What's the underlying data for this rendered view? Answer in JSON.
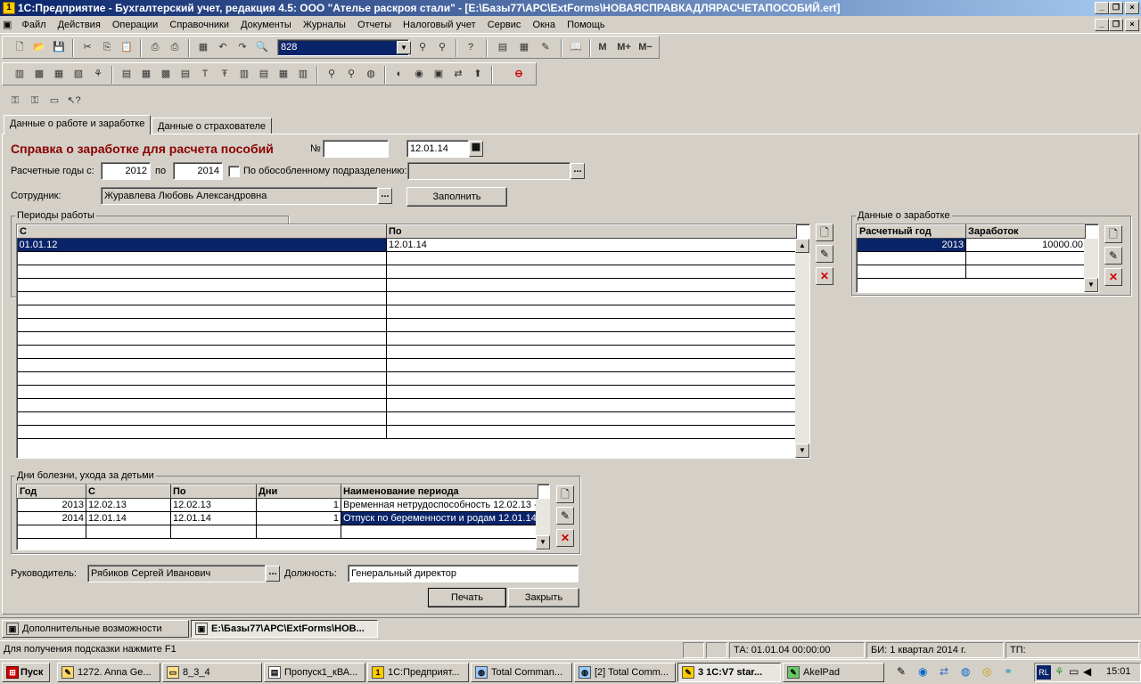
{
  "window": {
    "title": "1С:Предприятие - Бухгалтерский учет, редакция 4.5: ООО \"Ателье раскроя стали\" - [E:\\Базы77\\АРС\\ExtForms\\НОВАЯСПРАВКАДЛЯРАСЧЕТАПОСОБИЙ.ert]"
  },
  "menu": [
    "Файл",
    "Действия",
    "Операции",
    "Справочники",
    "Документы",
    "Журналы",
    "Отчеты",
    "Налоговый учет",
    "Сервис",
    "Окна",
    "Помощь"
  ],
  "toolbar": {
    "search_value": "828",
    "m_label": "M",
    "mplus_label": "M+",
    "mminus_label": "M−"
  },
  "tabs": [
    "Данные о работе и заработке",
    "Данные о страхователе"
  ],
  "form": {
    "title": "Справка о заработке для расчета пособий",
    "number_label": "№",
    "number_value": "",
    "date_value": "12.01.14",
    "years_label": "Расчетные годы с:",
    "year_from": "2012",
    "year_to_label": "по",
    "year_to": "2014",
    "subdivision_label": "По обособленному подразделению:",
    "subdivision_value": "",
    "employee_label": "Сотрудник:",
    "employee_value": "Журавлева Любовь Александровна",
    "fill_button": "Заполнить"
  },
  "periods": {
    "label": "Периоды работы",
    "columns": [
      "С",
      "По"
    ],
    "rows": [
      [
        "01.01.12",
        "12.01.14"
      ]
    ]
  },
  "earnings": {
    "label": "Данные о заработке",
    "columns": [
      "Расчетный год",
      "Заработок"
    ],
    "rows": [
      [
        "2013",
        "10000.00"
      ]
    ]
  },
  "sick": {
    "label": "Дни болезни, ухода за детьми",
    "columns": [
      "Год",
      "С",
      "По",
      "Дни",
      "Наименование периода"
    ],
    "rows": [
      [
        "2013",
        "12.02.13",
        "12.02.13",
        "1",
        "Временная нетрудоспособность 12.02.13 -"
      ],
      [
        "2014",
        "12.01.14",
        "12.01.14",
        "1",
        "Отпуск по беременности и родам 12.01.14"
      ]
    ]
  },
  "footer": {
    "manager_label": "Руководитель:",
    "manager_value": "Рябиков Сергей Иванович",
    "position_label": "Должность:",
    "position_value": "Генеральный директор",
    "print_button": "Печать",
    "close_button": "Закрыть"
  },
  "window_tabs": [
    "Дополнительные возможности",
    "E:\\Базы77\\АРС\\ExtForms\\НОВ..."
  ],
  "status": {
    "hint": "Для получения подсказки нажмите F1",
    "ta": "ТА: 01.01.04  00:00:00",
    "bi": "БИ: 1 квартал 2014 г.",
    "tp": "ТП:"
  },
  "taskbar": {
    "start": "Пуск",
    "items": [
      "1272. Anna Ge...",
      "8_3_4",
      "Пропуск1_кВА...",
      "1С:Предприят...",
      "Total Comman...",
      "[2] Total Comm...",
      "3 1C:V7 star...",
      "AkelPad"
    ],
    "lang": "RL",
    "clock": "15:01"
  }
}
